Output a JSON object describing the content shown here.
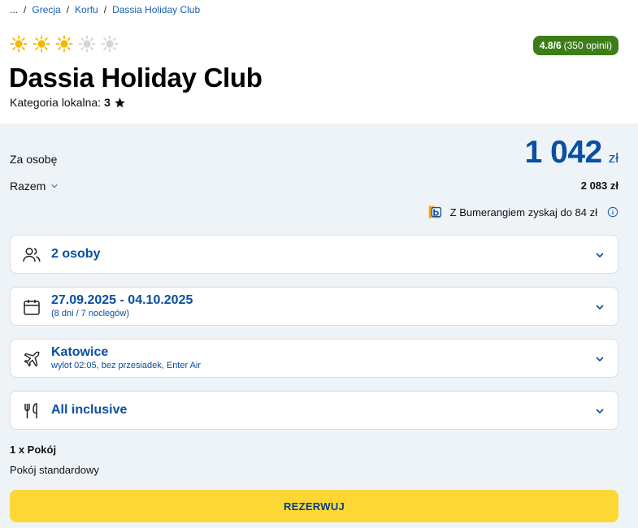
{
  "breadcrumb": {
    "ellipsis": "...",
    "items": [
      "Grecja",
      "Korfu",
      "Dassia Holiday Club"
    ],
    "separator": "/"
  },
  "hotel": {
    "suns_total": 5,
    "suns_filled": 3,
    "rating_score": "4.8/6",
    "rating_count": "(350 opinii)",
    "name": "Dassia Holiday Club",
    "category_label": "Kategoria lokalna:",
    "category_value": "3"
  },
  "price": {
    "per_person_label": "Za osobę",
    "per_person_amount": "1 042",
    "currency": "zł",
    "total_label": "Razem",
    "total_amount": "2 083 zł",
    "bumerang_text": "Z Bumerangiem zyskaj do 84 zł"
  },
  "options": {
    "guests": {
      "label": "2 osoby",
      "icon": "people-icon"
    },
    "dates": {
      "label": "27.09.2025 - 04.10.2025",
      "sub": "(8 dni / 7 noclegów)",
      "icon": "calendar-icon"
    },
    "flight": {
      "label": "Katowice",
      "sub": "wylot 02:05, bez przesiadek, Enter Air",
      "icon": "plane-icon"
    },
    "board": {
      "label": "All inclusive",
      "icon": "fork-knife-icon"
    }
  },
  "room": {
    "count": "1 x Pokój",
    "type": "Pokój standardowy"
  },
  "book_button": "REZERWUJ",
  "colors": {
    "brand_blue": "#0a4fa0",
    "link_blue": "#1a5fb4",
    "rating_green": "#3d7d18",
    "sun_active": "#f5b800",
    "sun_inactive": "#d5d5d5",
    "cta_yellow": "#fdd835",
    "panel_bg": "#eef3f8"
  }
}
